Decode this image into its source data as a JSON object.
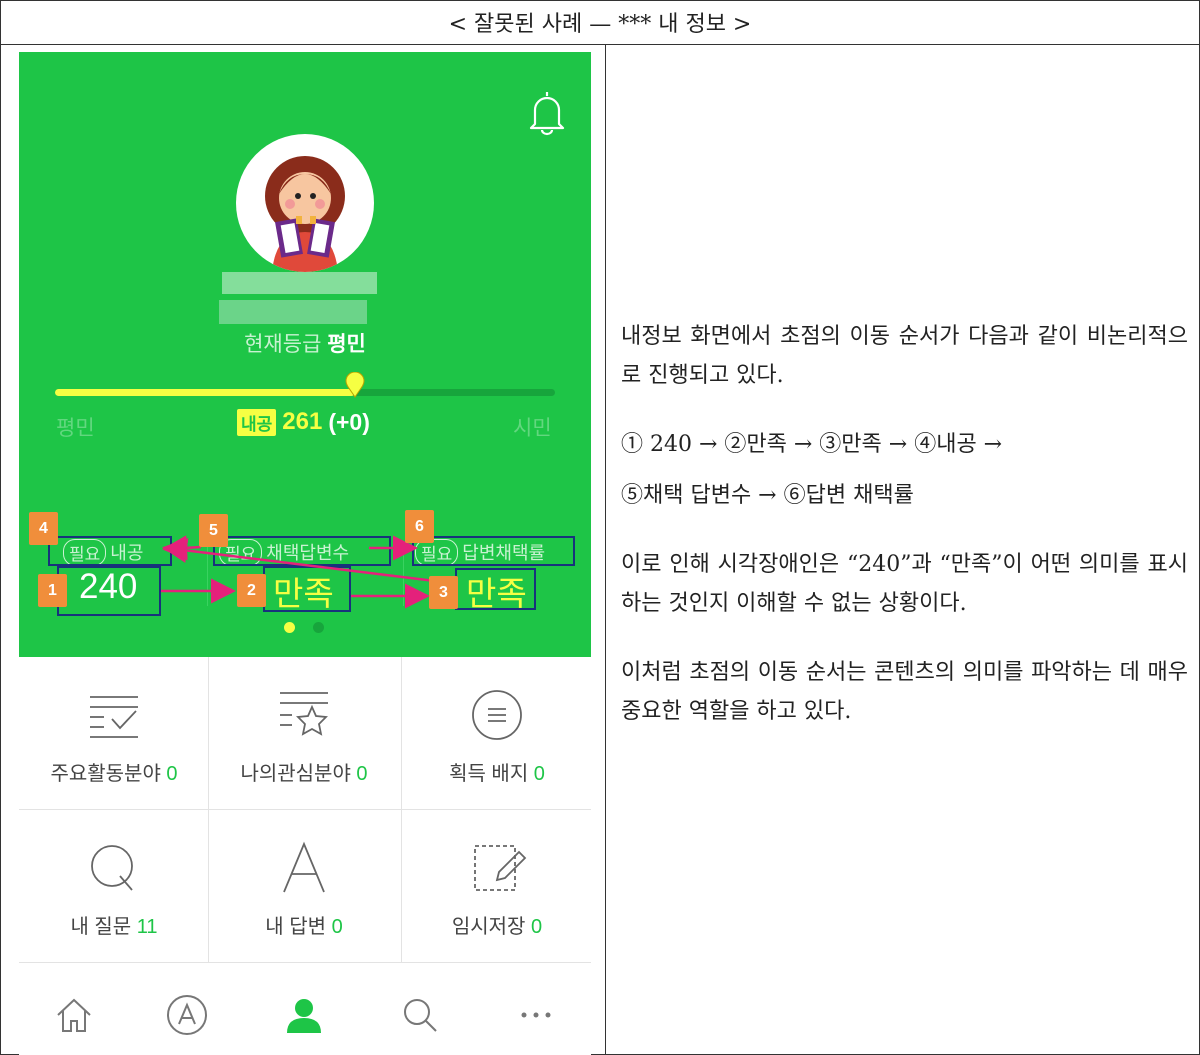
{
  "title": "< 잘못된 사례 — *** 내 정보 >",
  "profile": {
    "grade_label": "현재등급",
    "grade_value": "평민",
    "level_left": "평민",
    "level_right": "시민",
    "points_tag": "내공",
    "points_value": "261",
    "points_delta": "(+0)",
    "progress": 0.6
  },
  "stats": [
    {
      "pill": "필요",
      "label": "내공",
      "value": "240"
    },
    {
      "pill": "필요",
      "label": "채택답변수",
      "value": "만족"
    },
    {
      "pill": "필요",
      "label": "답변채택률",
      "value": "만족"
    }
  ],
  "focus_order": [
    "1",
    "2",
    "3",
    "4",
    "5",
    "6"
  ],
  "menu": [
    {
      "label": "주요활동분야",
      "count": "0",
      "icon": "list-check-icon"
    },
    {
      "label": "나의관심분야",
      "count": "0",
      "icon": "list-star-icon"
    },
    {
      "label": "획득 배지",
      "count": "0",
      "icon": "badge-menu-icon"
    },
    {
      "label": "내 질문",
      "count": "11",
      "icon": "question-q-icon"
    },
    {
      "label": "내 답변",
      "count": "0",
      "icon": "answer-a-icon"
    },
    {
      "label": "임시저장",
      "count": "0",
      "icon": "draft-pencil-icon"
    }
  ],
  "nav_icons": [
    "home-icon",
    "answer-circle-icon",
    "profile-icon",
    "search-icon",
    "more-icon"
  ],
  "colors": {
    "brand_green": "#1ec547",
    "highlight_yellow": "#f6ff43",
    "badge_orange": "#f08e3b",
    "focus_navy": "#18327c",
    "arrow_magenta": "#e4217b"
  },
  "description": {
    "p1": "내정보 화면에서 초점의 이동 순서가 다음과 같이 비논리적으로 진행되고 있다.",
    "seq1": "①  240 → ②만족 → ③만족 → ④내공 →",
    "seq2": "⑤채택 답변수 → ⑥답변 채택률",
    "p2": "이로 인해 시각장애인은 “240”과 “만족”이 어떤 의미를 표시하는 것인지 이해할 수 없는 상황이다.",
    "p3": "이처럼 초점의 이동 순서는 콘텐츠의 의미를 파악하는 데 매우 중요한 역할을 하고 있다."
  }
}
